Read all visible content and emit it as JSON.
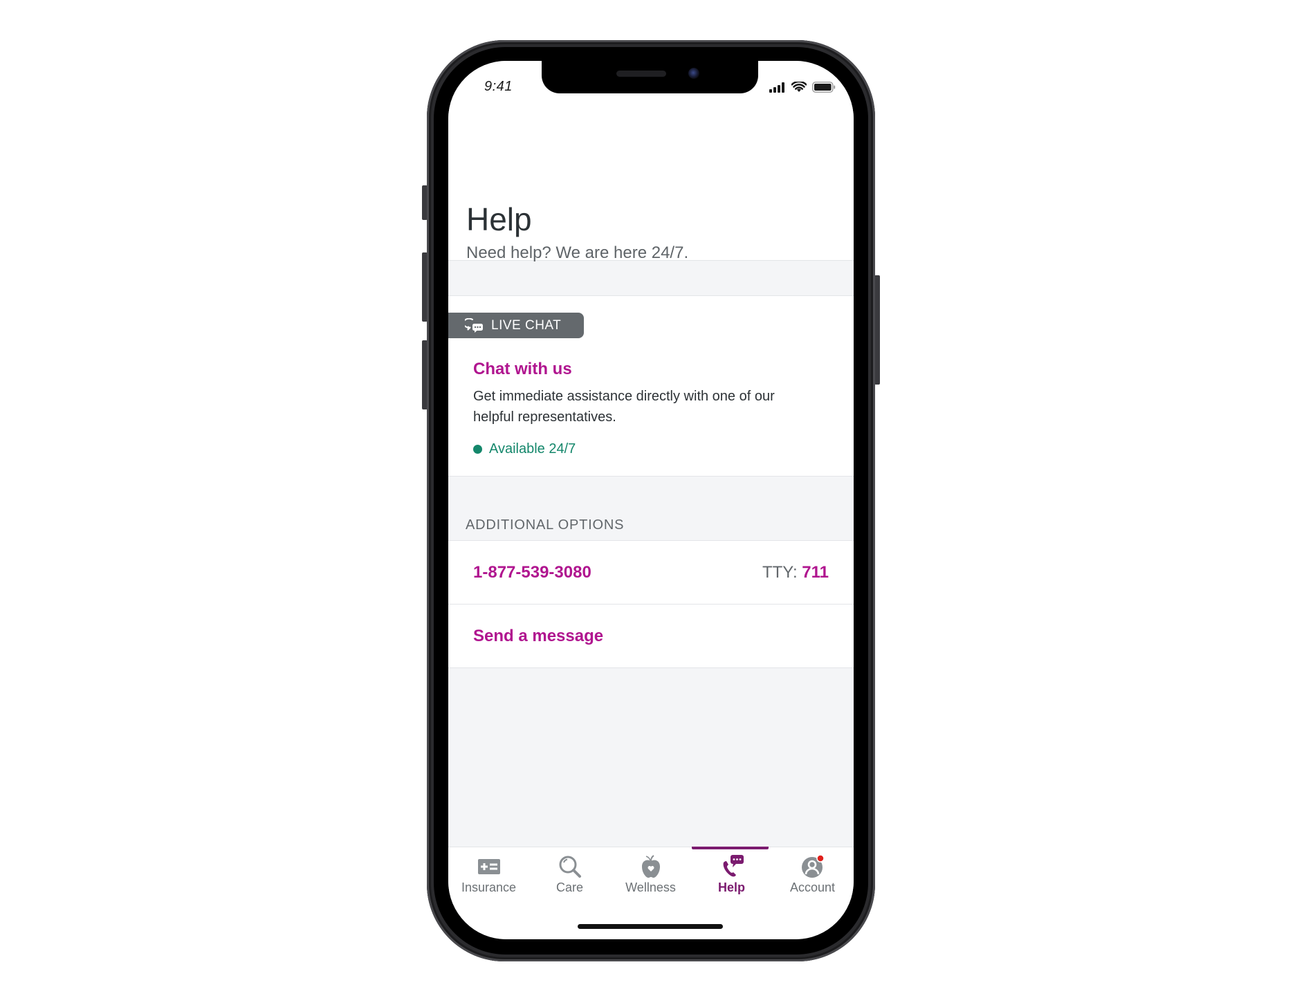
{
  "status_bar": {
    "time": "9:41",
    "icons": [
      "signal-icon",
      "wifi-icon",
      "battery-icon"
    ]
  },
  "header": {
    "title": "Help",
    "subtitle": "Need help? We are here 24/7."
  },
  "live_chat_card": {
    "badge_label": "LIVE CHAT",
    "badge_icon": "chat-bubbles-icon",
    "title": "Chat with us",
    "description": "Get immediate assistance directly with one of our helpful representatives.",
    "availability": "Available 24/7"
  },
  "additional_options": {
    "section_label": "ADDITIONAL OPTIONS",
    "phone_number": "1-877-539-3080",
    "tty_label": "TTY:",
    "tty_number": "711",
    "send_message_label": "Send a message"
  },
  "tab_bar": {
    "active": "Help",
    "tabs": [
      {
        "label": "Insurance",
        "icon": "insurance-card-icon"
      },
      {
        "label": "Care",
        "icon": "search-icon"
      },
      {
        "label": "Wellness",
        "icon": "apple-heart-icon"
      },
      {
        "label": "Help",
        "icon": "phone-chat-icon"
      },
      {
        "label": "Account",
        "icon": "account-icon",
        "has_notification": true
      }
    ]
  },
  "colors": {
    "brand_magenta": "#b0158f",
    "active_tab_purple": "#7b1b6f",
    "available_green": "#14876b",
    "badge_gray": "#64696d",
    "notification_red": "#e0201b"
  }
}
